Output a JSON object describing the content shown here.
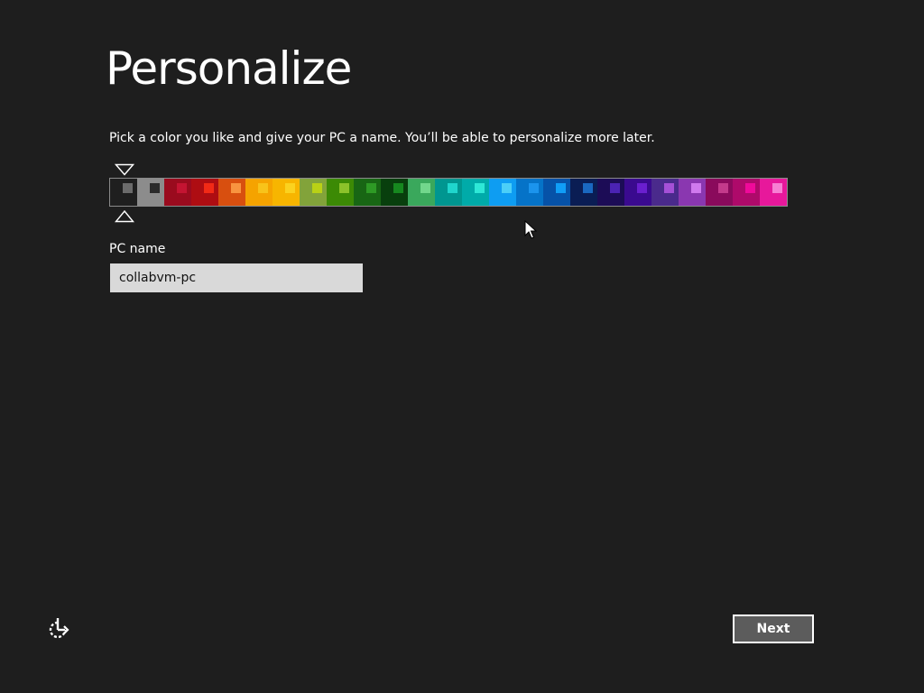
{
  "page": {
    "title": "Personalize",
    "subtitle": "Pick a color you like and give your PC a name. You’ll be able to personalize more later."
  },
  "color_picker": {
    "selected_index": 0,
    "swatches": [
      {
        "bg": "#1f1f1f",
        "chip": "#6b6b6b"
      },
      {
        "bg": "#8c8c8c",
        "chip": "#2b2b2b"
      },
      {
        "bg": "#9a0b1e",
        "chip": "#c41432"
      },
      {
        "bg": "#ae0d12",
        "chip": "#f22a16"
      },
      {
        "bg": "#d84f0f",
        "chip": "#f89440"
      },
      {
        "bg": "#f5a300",
        "chip": "#f8c31a"
      },
      {
        "bg": "#f7b500",
        "chip": "#fbd21f"
      },
      {
        "bg": "#82a33a",
        "chip": "#b9d116"
      },
      {
        "bg": "#3c8a05",
        "chip": "#8cc22a"
      },
      {
        "bg": "#186614",
        "chip": "#2e9a25"
      },
      {
        "bg": "#083f0d",
        "chip": "#16881f"
      },
      {
        "bg": "#3aa85c",
        "chip": "#72d78c"
      },
      {
        "bg": "#009690",
        "chip": "#1fd6cd"
      },
      {
        "bg": "#00aba9",
        "chip": "#2ee8d7"
      },
      {
        "bg": "#0e9df2",
        "chip": "#4bcff8"
      },
      {
        "bg": "#0573c8",
        "chip": "#1b94ed"
      },
      {
        "bg": "#0652a8",
        "chip": "#109ef7"
      },
      {
        "bg": "#0a1d54",
        "chip": "#1a68c0"
      },
      {
        "bg": "#1c0c56",
        "chip": "#4b23b3"
      },
      {
        "bg": "#3a0a8f",
        "chip": "#6a1fcf"
      },
      {
        "bg": "#4a2a8c",
        "chip": "#a550d7"
      },
      {
        "bg": "#8a37b0",
        "chip": "#d07aee"
      },
      {
        "bg": "#8a0a5c",
        "chip": "#c33a8b"
      },
      {
        "bg": "#ae0a6a",
        "chip": "#ef0a9a"
      },
      {
        "bg": "#e7189b",
        "chip": "#f77fd3"
      }
    ]
  },
  "pc_name": {
    "label": "PC name",
    "value": "collabvm-pc"
  },
  "footer": {
    "next_label": "Next",
    "ease_of_access_icon": "ease-of-access-icon"
  },
  "cursor_icon": "mouse-pointer-icon"
}
